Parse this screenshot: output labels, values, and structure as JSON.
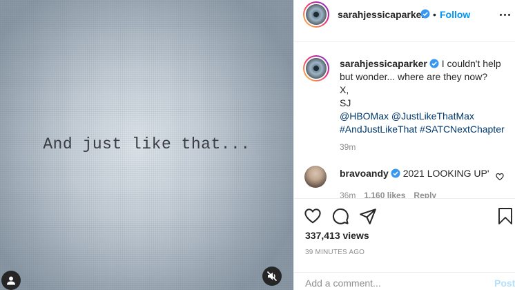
{
  "media": {
    "caption_text": "And just like that..."
  },
  "header": {
    "username": "sarahjessicaparker",
    "separator": "•",
    "follow_label": "Follow"
  },
  "caption": {
    "username": "sarahjessicaparker",
    "first_line": "I couldn't help but wonder... where are they now?",
    "line2": "X,",
    "line3": "SJ",
    "mention1": "@HBOMax",
    "mention2": "@JustLikeThatMax",
    "tag1": "#AndJustLikeThat",
    "tag2": "#SATCNextChapter",
    "time": "39m"
  },
  "comment": {
    "username": "bravoandy",
    "text": "2021 LOOKING UP'",
    "time": "36m",
    "likes": "1,160 likes",
    "reply": "Reply"
  },
  "stats": {
    "views": "337,413 views",
    "posted": "39 MINUTES AGO"
  },
  "composer": {
    "placeholder": "Add a comment...",
    "post_label": "Post"
  },
  "colors": {
    "accent": "#0095f6",
    "link": "#00376b",
    "muted": "#8e8e8e",
    "verified": "#3897f0"
  },
  "icons": [
    "user-tag-icon",
    "mute-icon",
    "verified-badge-icon",
    "more-icon",
    "heart-icon",
    "comment-icon",
    "share-icon",
    "save-icon"
  ]
}
